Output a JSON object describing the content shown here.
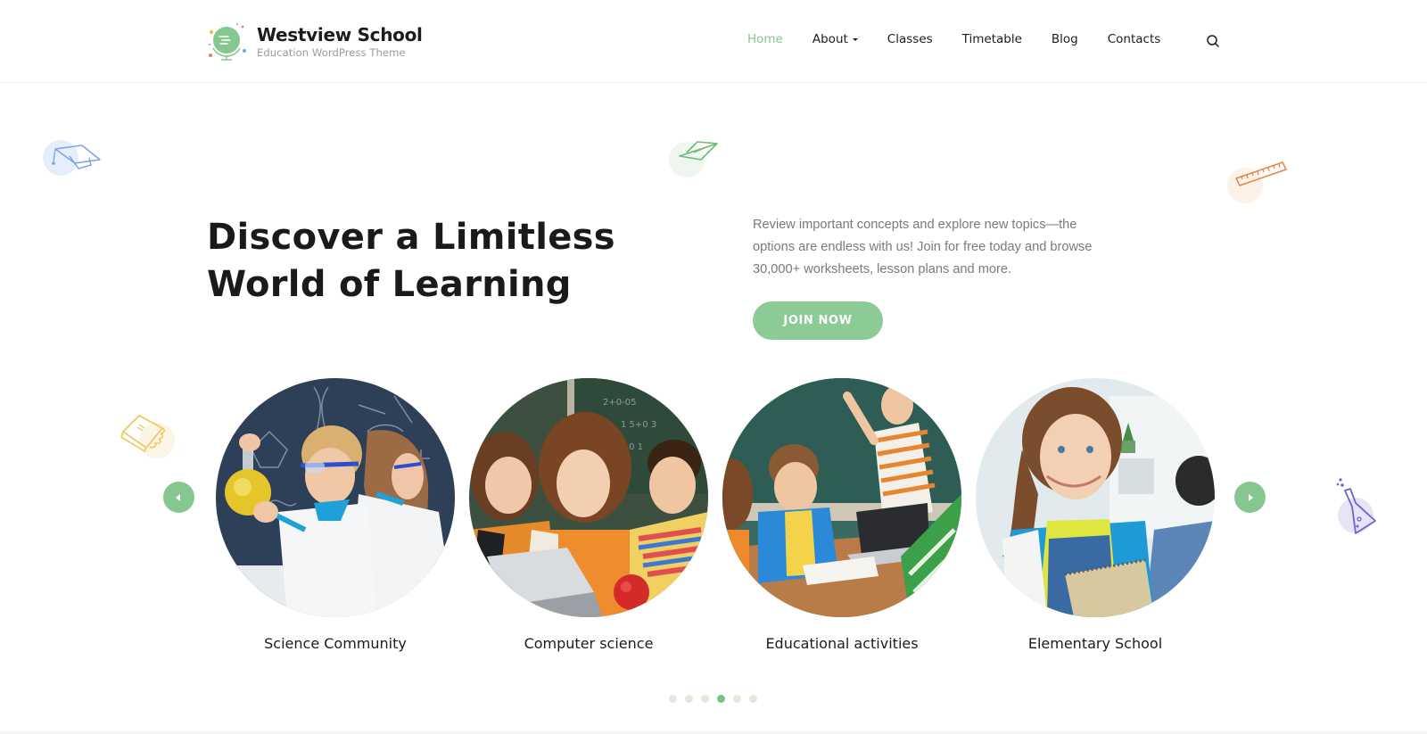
{
  "header": {
    "logo_title": "Westview School",
    "logo_subtitle": "Education WordPress Theme",
    "nav": [
      {
        "label": "Home",
        "active": true
      },
      {
        "label": "About",
        "has_dropdown": true
      },
      {
        "label": "Classes"
      },
      {
        "label": "Timetable"
      },
      {
        "label": "Blog"
      },
      {
        "label": "Contacts"
      }
    ],
    "search_icon": "search-icon"
  },
  "hero": {
    "title_line1": "Discover a Limitless",
    "title_line2": "World of Learning",
    "description": "Review important concepts and explore new topics—the options are endless with us! Join for free today and browse 30,000+ worksheets, lesson plans and more.",
    "cta_label": "JOIN NOW"
  },
  "carousel": {
    "items": [
      {
        "label": "Science Community",
        "image": "children-with-chemistry-flask"
      },
      {
        "label": "Computer science",
        "image": "students-at-laptop"
      },
      {
        "label": "Educational activities",
        "image": "classroom-teacher-at-board"
      },
      {
        "label": "Elementary School",
        "image": "girl-with-backpack"
      }
    ],
    "prev_icon": "chevron-left-icon",
    "next_icon": "chevron-right-icon",
    "pagination": {
      "total": 6,
      "active_index": 3
    }
  },
  "decorations": [
    "graduation-cap-icon",
    "paper-plane-icon",
    "ruler-icon",
    "notebook-icon",
    "flask-icon"
  ],
  "colors": {
    "accent": "#86c78f",
    "button": "#8dcb96",
    "text_dark": "#1a1a1a",
    "text_muted": "#7a7a7a",
    "dot_inactive": "#e6e7d9"
  }
}
